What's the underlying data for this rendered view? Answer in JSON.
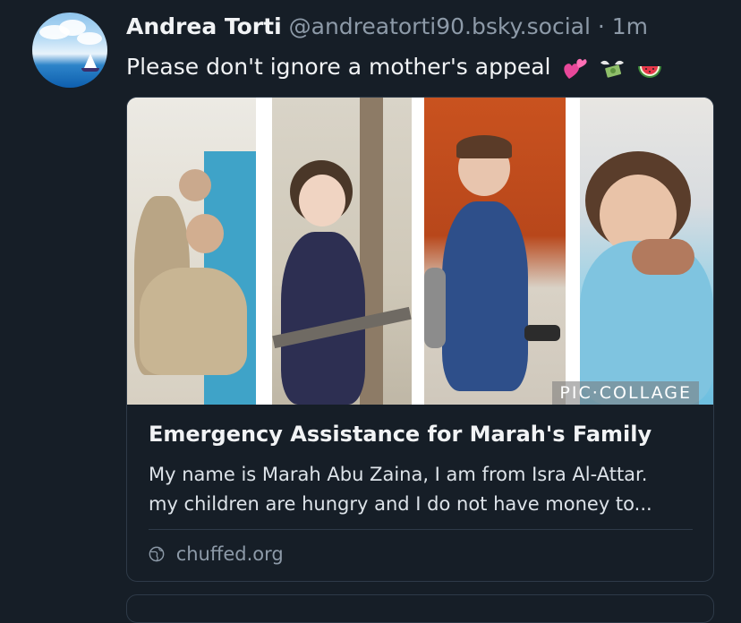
{
  "post": {
    "author_name": "Andrea Torti",
    "author_handle": "@andreatorti90.bsky.social",
    "separator": "·",
    "timestamp": "1m",
    "text": "Please don't ignore a mother's appeal",
    "emojis": [
      "two-hearts-emoji",
      "money-with-wings-emoji",
      "watermelon-emoji"
    ]
  },
  "link_card": {
    "image_watermark": "PIC·COLLAGE",
    "title": "Emergency Assistance for Marah's Family",
    "description_line1": "My name is Marah Abu Zaina, I am from Isra Al-Attar.",
    "description_line2": "my children are hungry and I do not have money to...",
    "domain": "chuffed.org",
    "domain_icon": "globe-icon"
  },
  "colors": {
    "background": "#161e27",
    "text_primary": "#f1f3f5",
    "text_secondary": "#8d9aa8",
    "border": "#2e3a48"
  }
}
